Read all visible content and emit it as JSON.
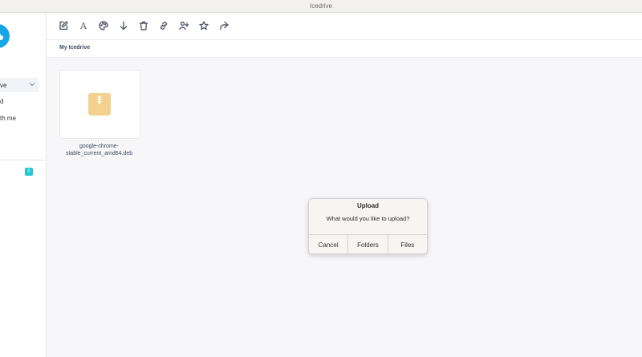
{
  "window": {
    "title": "Icedrive"
  },
  "sidebar": {
    "items": [
      {
        "label": "ve",
        "icon": "chevron-down-icon"
      },
      {
        "label": "d"
      },
      {
        "label": "th me"
      }
    ],
    "badge": "0"
  },
  "toolbar": {
    "tools": [
      {
        "name": "edit-icon"
      },
      {
        "name": "font-icon",
        "glyph": "A"
      },
      {
        "name": "palette-icon"
      },
      {
        "name": "download-icon"
      },
      {
        "name": "trash-icon"
      },
      {
        "name": "link-icon"
      },
      {
        "name": "add-user-icon"
      },
      {
        "name": "star-icon"
      },
      {
        "name": "share-icon"
      }
    ]
  },
  "breadcrumb": {
    "current": "My Icedrive"
  },
  "files": [
    {
      "name": "google-chrome-stable_current_amd64.deb",
      "line1": "google-chrome-",
      "line2": "stable_current_amd64.deb",
      "icon": "archive-icon"
    }
  ],
  "dialog": {
    "title": "Upload",
    "message": "What would you like to upload?",
    "buttons": {
      "cancel": "Cancel",
      "folders": "Folders",
      "files": "Files"
    }
  },
  "colors": {
    "accent": "#17a6e3",
    "badge": "#1fc8d0",
    "file_icon": "#f2d28e"
  }
}
